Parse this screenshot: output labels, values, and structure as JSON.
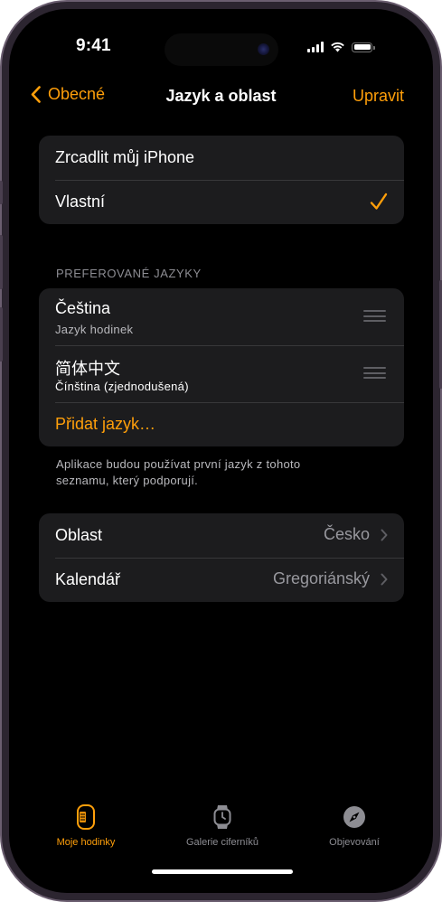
{
  "status_bar": {
    "time": "9:41",
    "battery_level": 1.0
  },
  "nav": {
    "back_label": "Obecné",
    "title": "Jazyk a oblast",
    "edit_label": "Upravit"
  },
  "language_mode": {
    "items": [
      {
        "label": "Zrcadlit můj iPhone",
        "selected": false
      },
      {
        "label": "Vlastní",
        "selected": true
      }
    ]
  },
  "preferred_languages": {
    "header": "PREFEROVANÉ JAZYKY",
    "items": [
      {
        "name": "Čeština",
        "subtitle": "Jazyk hodinek"
      },
      {
        "name": "简体中文",
        "subtitle": "Čínština (zjednodušená)"
      }
    ],
    "add_label": "Přidat jazyk…",
    "footer": "Aplikace budou používat první jazyk z tohoto seznamu, který podporují."
  },
  "region_settings": {
    "items": [
      {
        "label": "Oblast",
        "value": "Česko"
      },
      {
        "label": "Kalendář",
        "value": "Gregoriánský"
      }
    ]
  },
  "tab_bar": {
    "tabs": [
      {
        "label": "Moje hodinky",
        "icon": "watch-face-icon",
        "active": true
      },
      {
        "label": "Galerie ciferníků",
        "icon": "watch-icon",
        "active": false
      },
      {
        "label": "Objevování",
        "icon": "compass-icon",
        "active": false
      }
    ]
  },
  "colors": {
    "accent": "#ff9f0a",
    "background": "#000000",
    "group_background": "#1c1c1e",
    "secondary_text": "#98989e"
  }
}
